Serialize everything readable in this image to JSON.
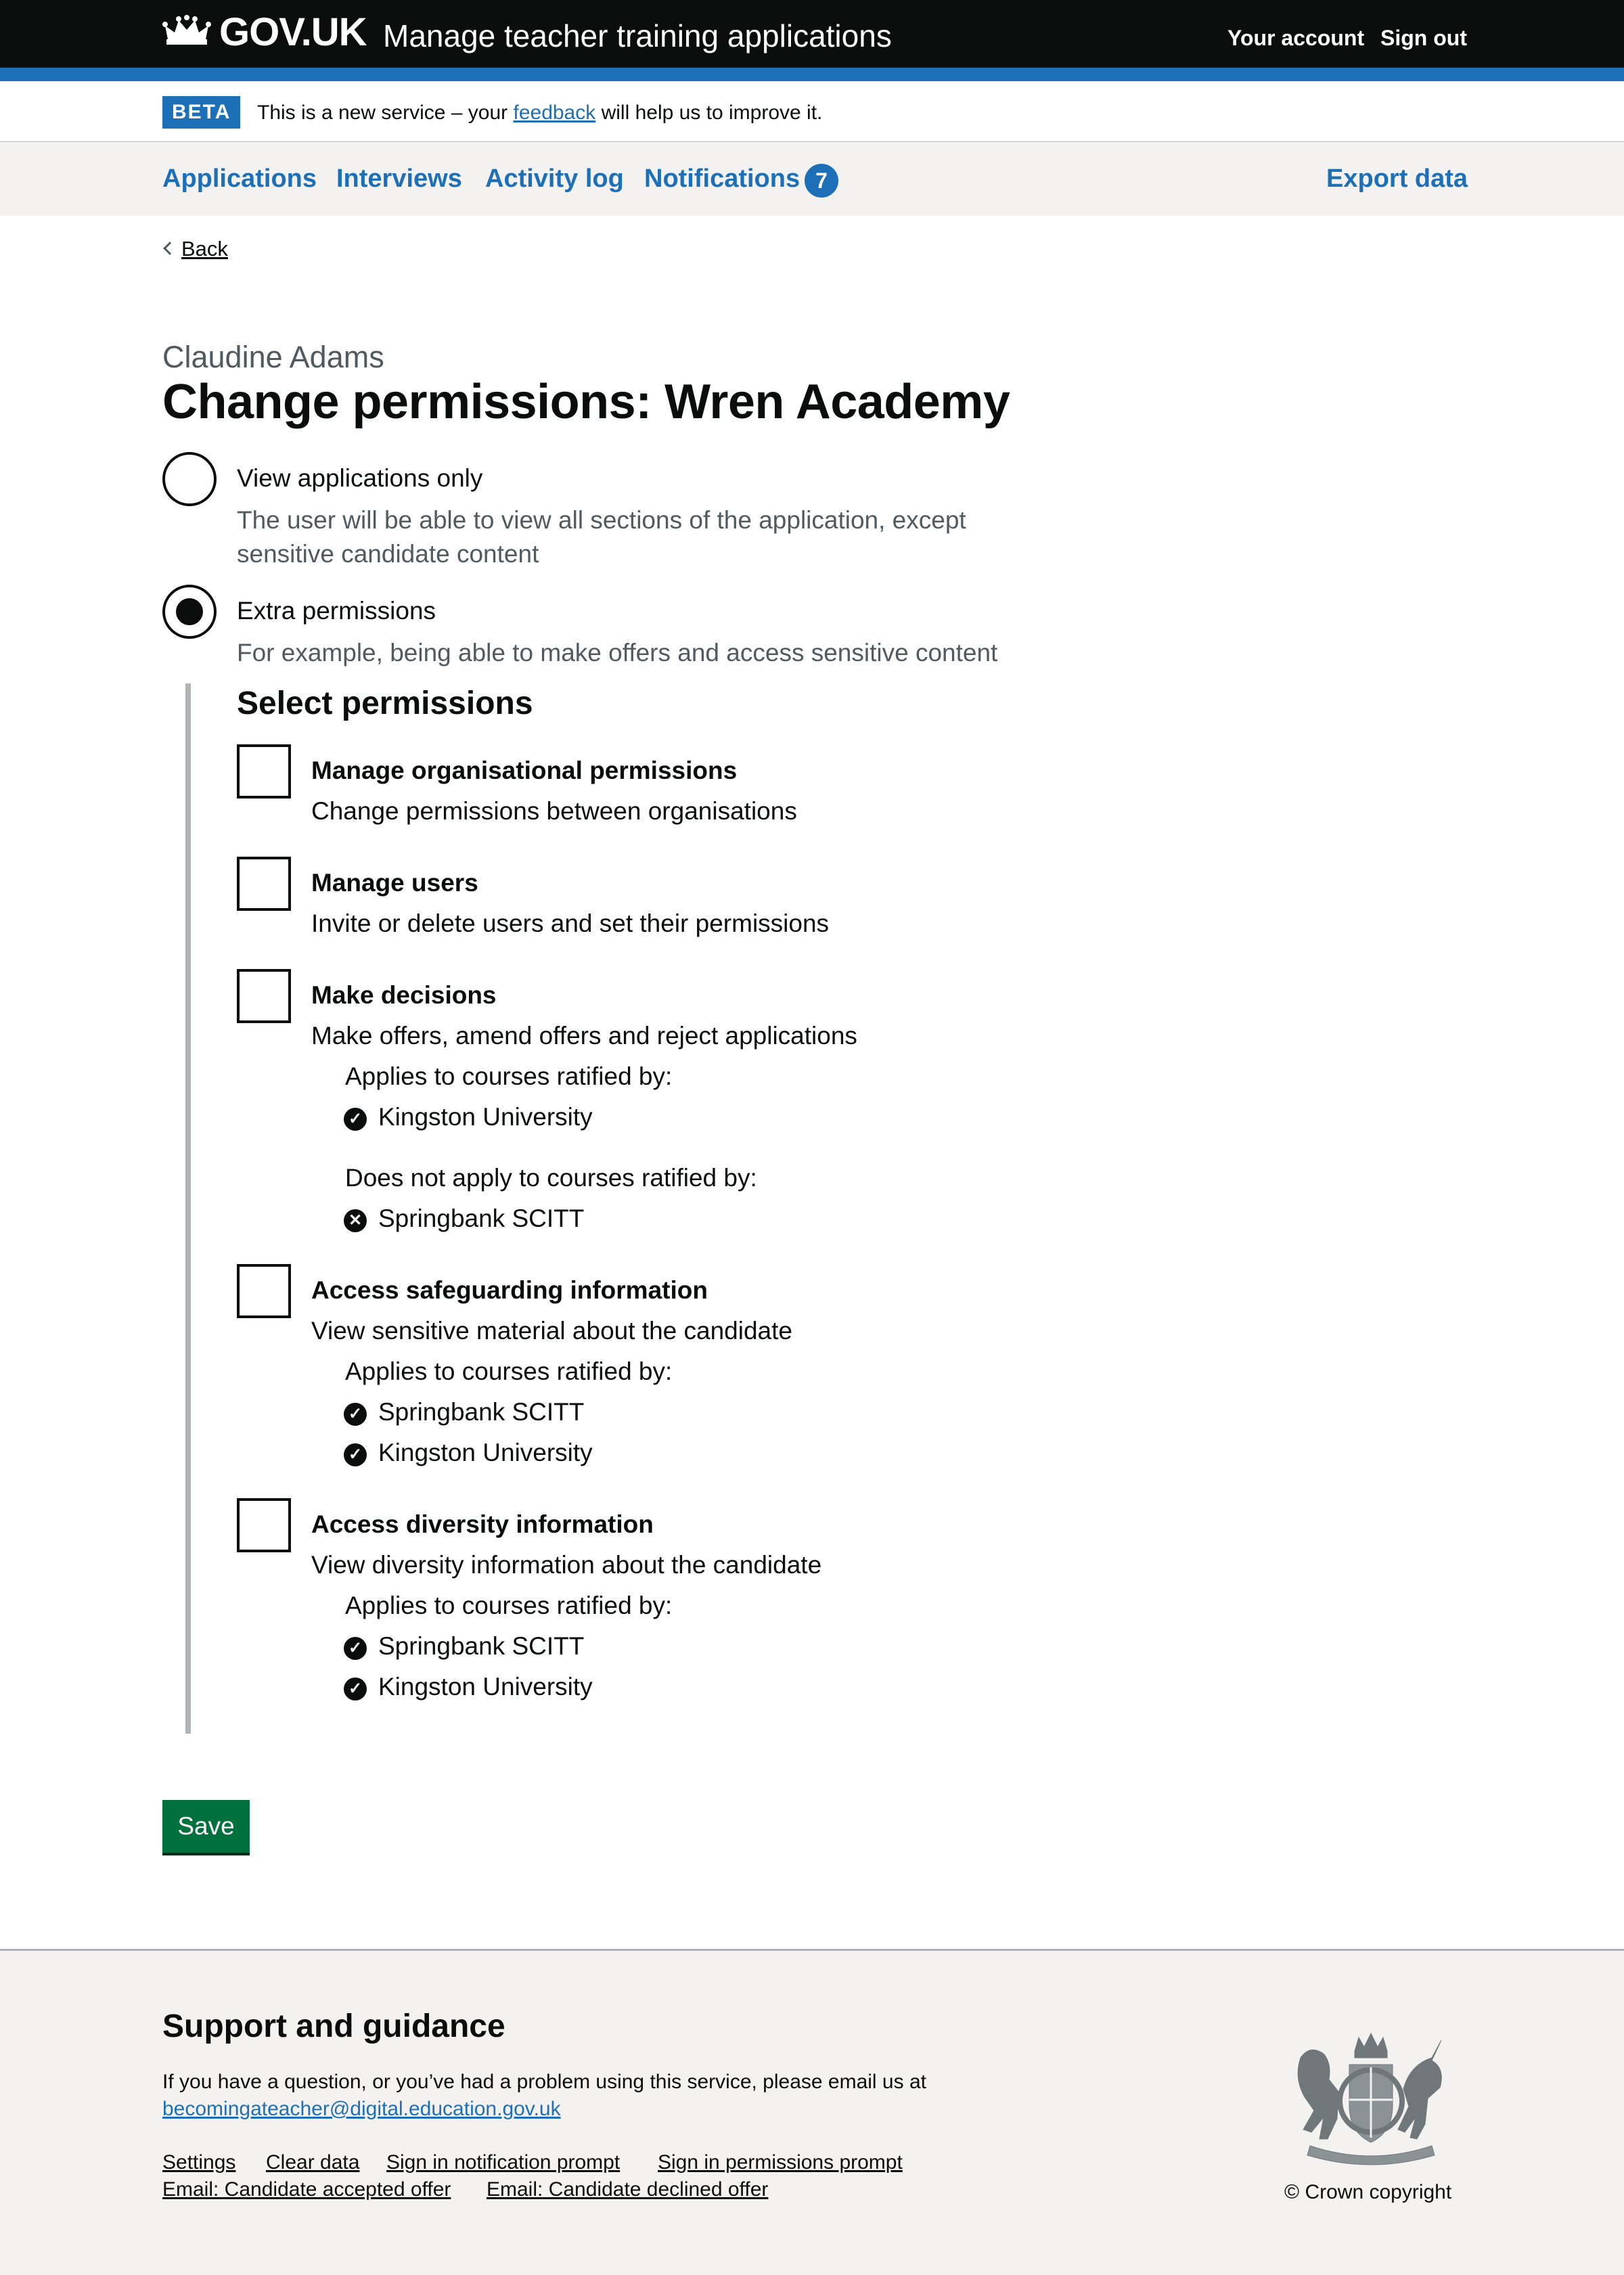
{
  "header": {
    "brand": "GOV.UK",
    "service_name": "Manage teacher training applications",
    "your_account": "Your account",
    "sign_out": "Sign out"
  },
  "beta": {
    "tag": "BETA",
    "text_before": "This is a new service – your ",
    "feedback_link": "feedback",
    "text_after": " will help us to improve it."
  },
  "nav": {
    "applications": "Applications",
    "interviews": "Interviews",
    "activity_log": "Activity log",
    "notifications": "Notifications",
    "notifications_count": "7",
    "export_data": "Export data"
  },
  "back": "Back",
  "page": {
    "caption": "Claudine Adams",
    "title": "Change permissions: Wren Academy"
  },
  "radios": [
    {
      "label": "View applications only",
      "hint_line1": "The user will be able to view all sections of the application, except",
      "hint_line2": "sensitive candidate content",
      "checked": false
    },
    {
      "label": "Extra permissions",
      "hint_line1": "For example, being able to make offers and access sensitive content",
      "checked": true
    }
  ],
  "select_permissions": {
    "heading": "Select permissions",
    "items": [
      {
        "label": "Manage organisational permissions",
        "hint": "Change permissions between organisations",
        "checked": false
      },
      {
        "label": "Manage users",
        "hint": "Invite or delete users and set their permissions",
        "checked": false
      },
      {
        "label": "Make decisions",
        "hint": "Make offers, amend offers and reject applications",
        "checked": false,
        "applies_heading": "Applies to courses ratified by:",
        "applies": [
          "Kingston University"
        ],
        "not_applies_heading": "Does not apply to courses ratified by:",
        "not_applies": [
          "Springbank SCITT"
        ]
      },
      {
        "label": "Access safeguarding information",
        "hint": "View sensitive material about the candidate",
        "checked": false,
        "applies_heading": "Applies to courses ratified by:",
        "applies": [
          "Springbank SCITT",
          "Kingston University"
        ]
      },
      {
        "label": "Access diversity information",
        "hint": "View diversity information about the candidate",
        "checked": false,
        "applies_heading": "Applies to courses ratified by:",
        "applies": [
          "Springbank SCITT",
          "Kingston University"
        ]
      }
    ]
  },
  "save_button": "Save",
  "footer": {
    "heading": "Support and guidance",
    "text": "If you have a question, or you’ve had a problem using this service, please email us at",
    "email": "becomingateacher@digital.education.gov.uk",
    "links_row1": [
      "Settings",
      "Clear data",
      "Sign in notification prompt",
      "Sign in permissions prompt"
    ],
    "links_row2": [
      "Email: Candidate accepted offer",
      "Email: Candidate declined offer"
    ],
    "copyright": "© Crown copyright"
  },
  "icons": {
    "check": "check-circle-icon",
    "cross": "cross-circle-icon",
    "crown": "crown-icon",
    "crest": "royal-coat-of-arms-icon"
  },
  "colors": {
    "brand_blue": "#1d70b8",
    "header_black": "#0b0c0c",
    "button_green": "#00703c",
    "hint_grey": "#505a5f",
    "light_grey": "#f3f2f1"
  }
}
